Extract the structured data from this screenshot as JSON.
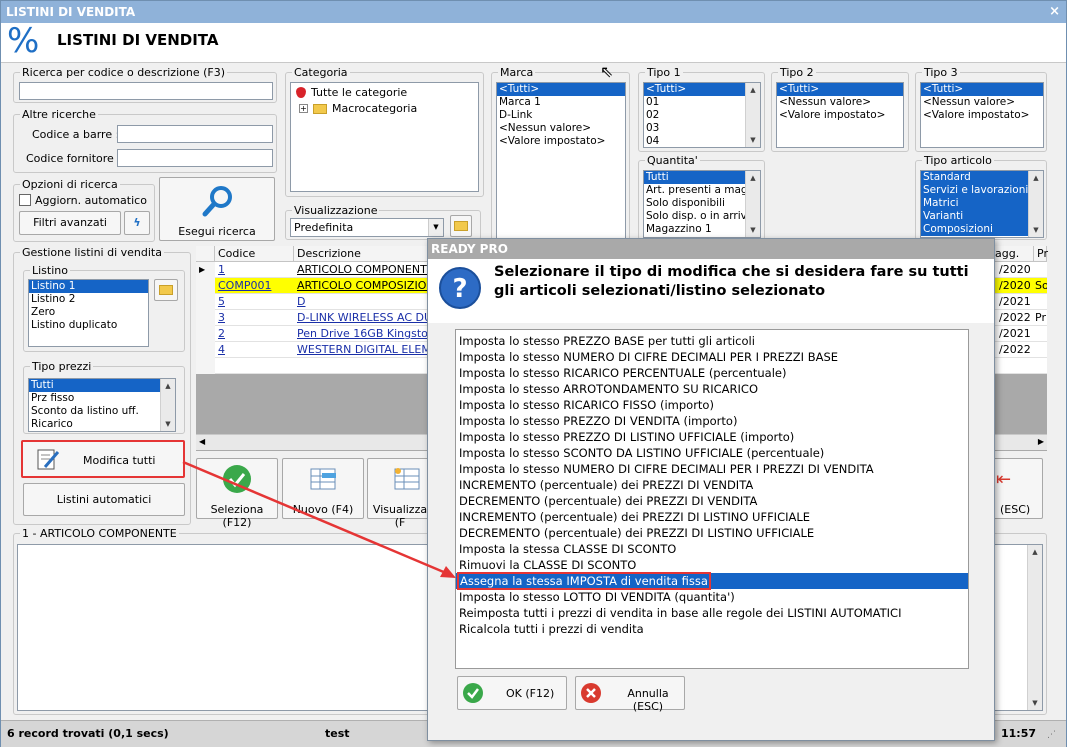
{
  "window": {
    "title": "LISTINI DI VENDITA",
    "close": "×",
    "heading": "LISTINI DI VENDITA",
    "app_icon": "%"
  },
  "search": {
    "codice_label": "Ricerca per codice o descrizione (F3)",
    "altre_label": "Altre ricerche",
    "barre_label": "Codice a barre :",
    "fornitore_label": "Codice fornitore :",
    "opzioni_label": "Opzioni di ricerca",
    "aggiorn_label": "Aggiorn. automatico",
    "filtri_label": "Filtri avanzati",
    "esegui_label": "Esegui ricerca"
  },
  "categoria": {
    "label": "Categoria",
    "items": [
      "Tutte le categorie",
      "Macrocategoria"
    ]
  },
  "visualizzazione": {
    "label": "Visualizzazione",
    "value": "Predefinita"
  },
  "marca": {
    "label": "Marca",
    "items": [
      "<Tutti>",
      "Marca 1",
      "D-Link",
      "<Nessun valore>",
      "<Valore impostato>"
    ]
  },
  "tipo1": {
    "label": "Tipo 1",
    "items": [
      "<Tutti>",
      "01",
      "02",
      "03",
      "04"
    ]
  },
  "tipo2": {
    "label": "Tipo 2",
    "items": [
      "<Tutti>",
      "<Nessun valore>",
      "<Valore impostato>"
    ]
  },
  "tipo3": {
    "label": "Tipo 3",
    "items": [
      "<Tutti>",
      "<Nessun valore>",
      "<Valore impostato>"
    ]
  },
  "quantita": {
    "label": "Quantita'",
    "items": [
      "Tutti",
      "Art. presenti a magazzino",
      "Solo disponibili",
      "Solo disp. o in arrivo",
      "Magazzino 1"
    ]
  },
  "tipo_articolo": {
    "label": "Tipo articolo",
    "items": [
      "Standard",
      "Servizi e lavorazioni",
      "Matrici",
      "Varianti",
      "Composizioni"
    ]
  },
  "gestione": {
    "label": "Gestione listini di vendita",
    "listino_label": "Listino",
    "listini": [
      "Listino 1",
      "Listino 2",
      "Zero",
      "Listino duplicato"
    ],
    "tipo_prezzi_label": "Tipo prezzi",
    "tipo_prezzi": [
      "Tutti",
      "Prz fisso",
      "Sconto da listino uff.",
      "Ricarico"
    ],
    "modifica_label": "Modifica tutti",
    "automatici_label": "Listini automatici"
  },
  "grid": {
    "headers": [
      "Codice",
      "Descrizione",
      "agg.",
      "Pr"
    ],
    "rows": [
      {
        "codice": "1",
        "descrizione": "ARTICOLO COMPONENTE",
        "agg": "/2020",
        "pr": ""
      },
      {
        "codice": "COMP001",
        "descrizione": "ARTICOLO COMPOSIZIONE",
        "agg": "/2020",
        "pr": "So"
      },
      {
        "codice": "5",
        "descrizione": "D",
        "agg": "/2021",
        "pr": ""
      },
      {
        "codice": "3",
        "descrizione": "D-LINK WIRELESS AC DUAL",
        "agg": "/2022",
        "pr": "Pr"
      },
      {
        "codice": "2",
        "descrizione": "Pen Drive 16GB Kingston",
        "agg": "/2021",
        "pr": ""
      },
      {
        "codice": "4",
        "descrizione": "WESTERN DIGITAL ELEMENT",
        "agg": "/2022",
        "pr": ""
      }
    ]
  },
  "toolbar": {
    "seleziona": "Seleziona (F12)",
    "nuovo": "Nuovo (F4)",
    "visualizza": "Visualizza (F",
    "esc": "(ESC)"
  },
  "detail": {
    "label": "1 - ARTICOLO COMPONENTE"
  },
  "status": {
    "records": "6 record trovati (0,1 secs)",
    "user": "test",
    "time": "11:57"
  },
  "dialog": {
    "title": "READY PRO",
    "question": "Selezionare il tipo di modifica che si desidera fare su tutti gli articoli selezionati/listino selezionato",
    "options": [
      "Imposta lo stesso PREZZO BASE per tutti gli articoli",
      "Imposta lo stesso NUMERO DI CIFRE DECIMALI PER I PREZZI BASE",
      "Imposta lo stesso RICARICO PERCENTUALE (percentuale)",
      "Imposta lo stesso ARROTONDAMENTO SU RICARICO",
      "Imposta lo stesso RICARICO FISSO (importo)",
      "Imposta lo stesso PREZZO DI VENDITA (importo)",
      "Imposta lo stesso PREZZO DI LISTINO UFFICIALE (importo)",
      "Imposta lo stesso SCONTO DA LISTINO UFFICIALE (percentuale)",
      "Imposta lo stesso NUMERO DI CIFRE DECIMALI PER I PREZZI DI VENDITA",
      "INCREMENTO (percentuale) dei PREZZI DI VENDITA",
      "DECREMENTO (percentuale) dei PREZZI DI VENDITA",
      "INCREMENTO (percentuale) dei PREZZI DI LISTINO UFFICIALE",
      "DECREMENTO (percentuale) dei PREZZI DI LISTINO UFFICIALE",
      "Imposta la stessa CLASSE DI SCONTO",
      "Rimuovi la CLASSE DI SCONTO",
      "Assegna la stessa IMPOSTA di vendita fissa",
      "Imposta lo stesso LOTTO DI VENDITA (quantita')",
      "Reimposta tutti i prezzi di vendita in base alle regole dei LISTINI AUTOMATICI",
      "Ricalcola tutti i prezzi di vendita"
    ],
    "ok": "OK (F12)",
    "cancel": "Annulla (ESC)"
  },
  "colors": {
    "selection": "#1564c6",
    "highlight_row": "#ffff00",
    "annotation": "#e53535",
    "ok_green": "#3aa84a",
    "cancel_red": "#d93a2f"
  }
}
